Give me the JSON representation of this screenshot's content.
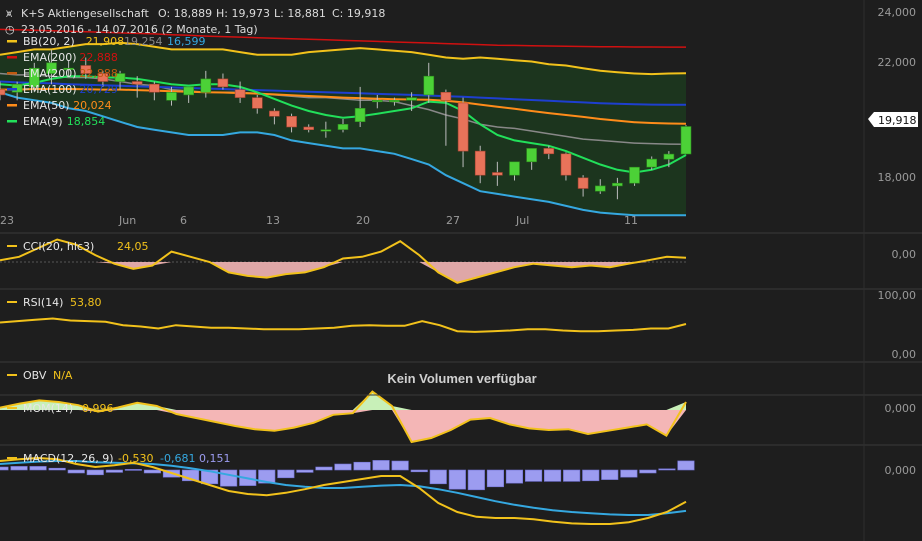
{
  "header": {
    "title": "K+S Aktiengesellschaft",
    "open": "O: 18,889",
    "high": "H: 19,973",
    "low": "L: 18,881",
    "close": "C: 19,918",
    "range": "23.05.2016 - 14.07.2016 (2 Monate, 1 Tag)"
  },
  "legend": [
    {
      "label": "BB(20, 2)",
      "value": "21,908",
      "extra1": "19,254",
      "extra2": "16,599",
      "color": "#f2c21b"
    },
    {
      "label": "EMA(200)",
      "value": "22,888",
      "color": "#d01010"
    },
    {
      "label": "EMA(200)",
      "value": "22,888",
      "color": "#c05a10"
    },
    {
      "label": "EMA(100)",
      "value": "20,729",
      "color": "#1e3fd0"
    },
    {
      "label": "EMA(50)",
      "value": "20,024",
      "color": "#ff8c1a"
    },
    {
      "label": "EMA(9)",
      "value": "18,854",
      "color": "#22e05a"
    }
  ],
  "price_axis": [
    "24,000",
    "22,000",
    "18,000"
  ],
  "last_price": "19,918",
  "x_ticks": [
    "23",
    "Jun",
    "6",
    "13",
    "20",
    "27",
    "Jul",
    "11"
  ],
  "panels": {
    "cci": {
      "label": "CCI(20, hlc3)",
      "value": "24,05",
      "axis": "0,00"
    },
    "rsi": {
      "label": "RSI(14)",
      "value": "53,80",
      "axis_top": "100,00",
      "axis_bottom": "0,00"
    },
    "obv": {
      "label": "OBV",
      "value": "N/A",
      "message": "Kein Volumen verfügbar"
    },
    "mom": {
      "label": "MOM(14)",
      "value": "0,996",
      "axis": "0,000"
    },
    "macd": {
      "label": "MACD(12, 26, 9)",
      "value": "-0,530",
      "extra1": "-0,681",
      "extra2": "0,151",
      "axis": "0,000"
    }
  },
  "colors": {
    "up": "#4cd137",
    "down": "#e8735a",
    "bb": "#f2c21b",
    "ema200": "#d01010",
    "ema100": "#1e3fd0",
    "ema50": "#ff8c1a",
    "ema9": "#22e05a",
    "mid": "#888888",
    "cci": "#f2c21b",
    "fill_neg": "#f4b6b6",
    "fill_pos": "#c8f0b8",
    "macd_hist": "#9c9cf0",
    "signal": "#35a8e0"
  },
  "chart_data": {
    "type": "candlestick",
    "title": "K+S Aktiengesellschaft",
    "x_range": [
      "23.05.2016",
      "14.07.2016"
    ],
    "ylim": [
      16.2,
      24.2
    ],
    "candles": [
      {
        "o": 21.3,
        "h": 21.6,
        "l": 20.9,
        "c": 21.1
      },
      {
        "o": 21.2,
        "h": 21.6,
        "l": 20.9,
        "c": 21.5
      },
      {
        "o": 21.4,
        "h": 22.3,
        "l": 21.2,
        "c": 22.1
      },
      {
        "o": 21.9,
        "h": 22.8,
        "l": 21.5,
        "c": 22.3
      },
      {
        "o": 22.1,
        "h": 22.4,
        "l": 21.8,
        "c": 22.1
      },
      {
        "o": 22.2,
        "h": 22.5,
        "l": 21.7,
        "c": 21.9
      },
      {
        "o": 21.9,
        "h": 22.0,
        "l": 21.4,
        "c": 21.6
      },
      {
        "o": 21.6,
        "h": 22.0,
        "l": 21.3,
        "c": 21.9
      },
      {
        "o": 21.6,
        "h": 21.8,
        "l": 21.0,
        "c": 21.5
      },
      {
        "o": 21.5,
        "h": 21.6,
        "l": 20.9,
        "c": 21.2
      },
      {
        "o": 20.9,
        "h": 21.4,
        "l": 20.7,
        "c": 21.2
      },
      {
        "o": 21.1,
        "h": 21.2,
        "l": 20.8,
        "c": 21.4
      },
      {
        "o": 21.2,
        "h": 22.0,
        "l": 21.0,
        "c": 21.7
      },
      {
        "o": 21.7,
        "h": 21.9,
        "l": 21.3,
        "c": 21.4
      },
      {
        "o": 21.3,
        "h": 21.6,
        "l": 20.8,
        "c": 21.0
      },
      {
        "o": 21.0,
        "h": 21.1,
        "l": 20.4,
        "c": 20.6
      },
      {
        "o": 20.5,
        "h": 20.6,
        "l": 20.0,
        "c": 20.3
      },
      {
        "o": 20.3,
        "h": 20.4,
        "l": 19.7,
        "c": 19.9
      },
      {
        "o": 19.9,
        "h": 20.0,
        "l": 19.7,
        "c": 19.8
      },
      {
        "o": 19.8,
        "h": 20.1,
        "l": 19.5,
        "c": 19.8
      },
      {
        "o": 19.8,
        "h": 20.2,
        "l": 19.7,
        "c": 20.0
      },
      {
        "o": 20.1,
        "h": 21.4,
        "l": 19.9,
        "c": 20.6
      },
      {
        "o": 20.9,
        "h": 21.1,
        "l": 20.6,
        "c": 20.9
      },
      {
        "o": 20.9,
        "h": 21.0,
        "l": 20.7,
        "c": 20.9
      },
      {
        "o": 20.9,
        "h": 21.2,
        "l": 20.5,
        "c": 21.0
      },
      {
        "o": 21.1,
        "h": 22.3,
        "l": 20.8,
        "c": 21.8
      },
      {
        "o": 21.2,
        "h": 21.3,
        "l": 19.2,
        "c": 20.9
      },
      {
        "o": 20.8,
        "h": 21.0,
        "l": 18.4,
        "c": 19.0
      },
      {
        "o": 19.0,
        "h": 19.2,
        "l": 17.8,
        "c": 18.1
      },
      {
        "o": 18.2,
        "h": 18.6,
        "l": 17.7,
        "c": 18.1
      },
      {
        "o": 18.1,
        "h": 18.6,
        "l": 17.9,
        "c": 18.6
      },
      {
        "o": 18.6,
        "h": 19.1,
        "l": 18.3,
        "c": 19.1
      },
      {
        "o": 19.1,
        "h": 19.2,
        "l": 18.7,
        "c": 18.9
      },
      {
        "o": 18.9,
        "h": 18.95,
        "l": 17.9,
        "c": 18.1
      },
      {
        "o": 18.0,
        "h": 18.1,
        "l": 17.3,
        "c": 17.6
      },
      {
        "o": 17.5,
        "h": 17.95,
        "l": 17.4,
        "c": 17.7
      },
      {
        "o": 17.7,
        "h": 18.0,
        "l": 17.2,
        "c": 17.8
      },
      {
        "o": 17.8,
        "h": 18.4,
        "l": 17.7,
        "c": 18.4
      },
      {
        "o": 18.4,
        "h": 18.8,
        "l": 18.3,
        "c": 18.7
      },
      {
        "o": 18.7,
        "h": 19.0,
        "l": 18.4,
        "c": 18.889
      },
      {
        "o": 18.889,
        "h": 19.973,
        "l": 18.881,
        "c": 19.918
      }
    ],
    "bb_upper": [
      22.6,
      22.7,
      22.8,
      22.8,
      22.9,
      23.0,
      23.0,
      23.05,
      23.0,
      22.9,
      22.8,
      22.8,
      22.8,
      22.8,
      22.7,
      22.6,
      22.6,
      22.6,
      22.7,
      22.75,
      22.8,
      22.85,
      22.8,
      22.75,
      22.7,
      22.6,
      22.5,
      22.45,
      22.5,
      22.45,
      22.4,
      22.35,
      22.25,
      22.2,
      22.1,
      22.0,
      21.95,
      21.9,
      21.88,
      21.9,
      21.908
    ],
    "bb_lower": [
      21.2,
      21.0,
      20.9,
      20.8,
      20.6,
      20.5,
      20.3,
      20.1,
      19.9,
      19.8,
      19.7,
      19.6,
      19.6,
      19.6,
      19.7,
      19.7,
      19.6,
      19.4,
      19.3,
      19.2,
      19.1,
      19.1,
      19.0,
      18.9,
      18.7,
      18.5,
      18.1,
      17.8,
      17.5,
      17.4,
      17.3,
      17.2,
      17.1,
      16.95,
      16.8,
      16.7,
      16.65,
      16.6,
      16.6,
      16.6,
      16.599
    ],
    "bb_middle": [
      21.9,
      21.85,
      21.85,
      21.8,
      21.75,
      21.75,
      21.7,
      21.6,
      21.5,
      21.45,
      21.3,
      21.25,
      21.2,
      21.2,
      21.2,
      21.15,
      21.1,
      21.05,
      21.0,
      21.0,
      20.95,
      20.9,
      20.9,
      20.85,
      20.7,
      20.55,
      20.35,
      20.2,
      20.0,
      19.9,
      19.85,
      19.75,
      19.65,
      19.55,
      19.45,
      19.4,
      19.35,
      19.3,
      19.28,
      19.26,
      19.254
    ],
    "ema200": [
      23.55,
      23.54,
      23.52,
      23.5,
      23.48,
      23.46,
      23.44,
      23.42,
      23.4,
      23.38,
      23.35,
      23.33,
      23.3,
      23.28,
      23.26,
      23.24,
      23.22,
      23.2,
      23.18,
      23.16,
      23.14,
      23.12,
      23.1,
      23.08,
      23.06,
      23.04,
      23.02,
      23.0,
      22.98,
      22.96,
      22.95,
      22.94,
      22.93,
      22.92,
      22.91,
      22.9,
      22.9,
      22.89,
      22.89,
      22.888,
      22.888
    ],
    "ema100": [
      21.6,
      21.57,
      21.55,
      21.53,
      21.5,
      21.48,
      21.46,
      21.44,
      21.42,
      21.4,
      21.38,
      21.36,
      21.34,
      21.32,
      21.3,
      21.28,
      21.26,
      21.24,
      21.22,
      21.2,
      21.18,
      21.16,
      21.14,
      21.12,
      21.1,
      21.08,
      21.05,
      21.03,
      21.0,
      20.97,
      20.94,
      20.91,
      20.88,
      20.85,
      20.82,
      20.79,
      20.77,
      20.75,
      20.74,
      20.73,
      20.729
    ],
    "ema50": [
      21.3,
      21.3,
      21.32,
      21.32,
      21.32,
      21.31,
      21.3,
      21.3,
      21.28,
      21.26,
      21.24,
      21.22,
      21.2,
      21.19,
      21.17,
      21.15,
      21.12,
      21.09,
      21.06,
      21.03,
      21.0,
      20.98,
      20.96,
      20.94,
      20.93,
      20.92,
      20.88,
      20.82,
      20.74,
      20.66,
      20.58,
      20.5,
      20.42,
      20.35,
      20.28,
      20.2,
      20.14,
      20.08,
      20.05,
      20.03,
      20.024
    ],
    "ema9": [
      21.5,
      21.45,
      21.55,
      21.7,
      21.8,
      21.8,
      21.75,
      21.75,
      21.7,
      21.6,
      21.5,
      21.45,
      21.5,
      21.5,
      21.4,
      21.2,
      20.95,
      20.7,
      20.5,
      20.35,
      20.25,
      20.3,
      20.4,
      20.5,
      20.6,
      20.85,
      20.8,
      20.5,
      20.0,
      19.6,
      19.4,
      19.3,
      19.2,
      19.0,
      18.75,
      18.5,
      18.3,
      18.2,
      18.3,
      18.5,
      18.854
    ],
    "cci": [
      10,
      30,
      80,
      130,
      100,
      40,
      -10,
      -40,
      -20,
      60,
      30,
      0,
      -60,
      -80,
      -90,
      -70,
      -60,
      -30,
      20,
      30,
      60,
      120,
      40,
      -60,
      -120,
      -90,
      -60,
      -30,
      -10,
      -20,
      -30,
      -20,
      -30,
      -10,
      10,
      30,
      24.05
    ],
    "rsi": [
      56,
      58,
      60,
      62,
      59,
      58,
      57,
      52,
      50,
      47,
      52,
      50,
      48,
      48,
      47,
      46,
      46,
      46,
      47,
      48,
      51,
      52,
      51,
      51,
      58,
      52,
      43,
      42,
      43,
      44,
      46,
      46,
      44,
      43,
      43,
      44,
      45,
      47,
      47,
      53.8
    ],
    "mom": [
      0.3,
      0.8,
      1.2,
      1.0,
      0.6,
      -0.2,
      0.3,
      0.9,
      0.5,
      -0.5,
      -1.0,
      -1.5,
      -2.0,
      -2.4,
      -2.6,
      -2.2,
      -1.6,
      -0.6,
      -0.4,
      2.3,
      0.5,
      -4.0,
      -3.5,
      -2.5,
      -1.2,
      -1.0,
      -1.8,
      -2.3,
      -2.5,
      -2.4,
      -3.0,
      -2.6,
      -2.2,
      -1.8,
      -3.2,
      0.996
    ],
    "macd": [
      0.15,
      0.18,
      0.2,
      0.18,
      0.1,
      0.05,
      0.08,
      0.12,
      0.05,
      -0.05,
      -0.15,
      -0.25,
      -0.35,
      -0.4,
      -0.42,
      -0.38,
      -0.32,
      -0.25,
      -0.2,
      -0.15,
      -0.1,
      -0.1,
      -0.3,
      -0.55,
      -0.7,
      -0.78,
      -0.8,
      -0.8,
      -0.82,
      -0.86,
      -0.89,
      -0.9,
      -0.9,
      -0.87,
      -0.8,
      -0.7,
      -0.53
    ],
    "signal": [
      0.1,
      0.12,
      0.14,
      0.15,
      0.15,
      0.13,
      0.12,
      0.11,
      0.1,
      0.07,
      0.03,
      -0.02,
      -0.08,
      -0.14,
      -0.2,
      -0.25,
      -0.28,
      -0.3,
      -0.3,
      -0.28,
      -0.26,
      -0.25,
      -0.27,
      -0.32,
      -0.38,
      -0.45,
      -0.52,
      -0.58,
      -0.63,
      -0.67,
      -0.7,
      -0.72,
      -0.74,
      -0.75,
      -0.75,
      -0.72,
      -0.681
    ],
    "macd_hist": [
      0.05,
      0.06,
      0.06,
      0.03,
      -0.05,
      -0.08,
      -0.04,
      0.01,
      -0.05,
      -0.12,
      -0.18,
      -0.23,
      -0.27,
      -0.26,
      -0.22,
      -0.13,
      -0.04,
      0.05,
      0.1,
      0.13,
      0.16,
      0.15,
      -0.03,
      -0.23,
      -0.32,
      -0.33,
      -0.28,
      -0.22,
      -0.19,
      -0.19,
      -0.19,
      -0.18,
      -0.16,
      -0.12,
      -0.05,
      0.02,
      0.151
    ]
  }
}
